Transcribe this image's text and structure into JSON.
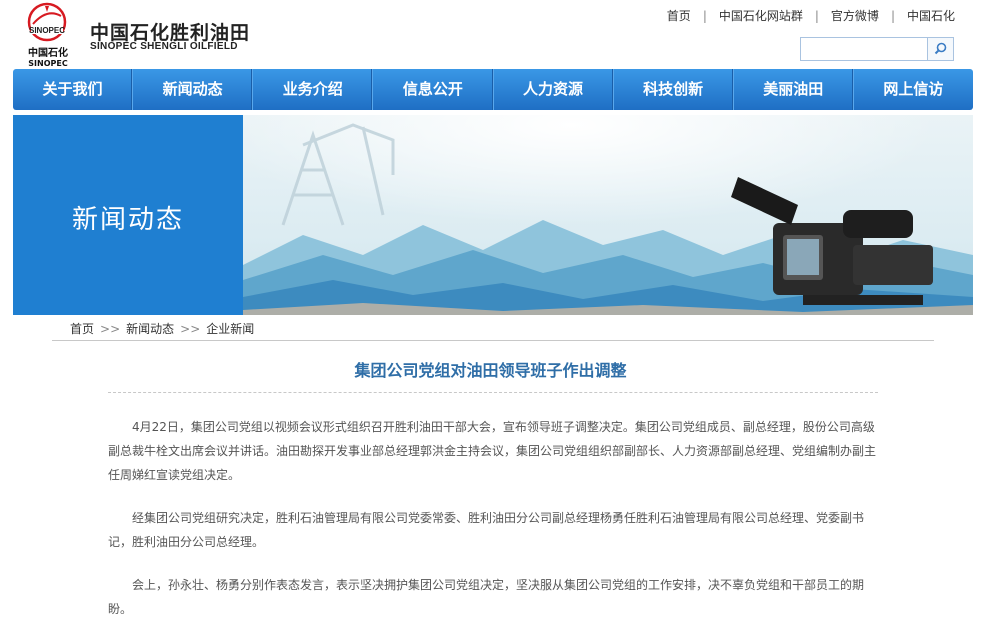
{
  "header": {
    "logo_cn": "中国石化",
    "logo_en": "SINOPEC",
    "brand_cn": "中国石化胜利油田",
    "brand_en": "SINOPEC SHENGLI OILFIELD",
    "top_links": [
      "首页",
      "中国石化网站群",
      "官方微博",
      "中国石化"
    ],
    "search": {
      "placeholder": "",
      "value": "",
      "button_icon": "search-icon"
    }
  },
  "nav": {
    "items": [
      "关于我们",
      "新闻动态",
      "业务介绍",
      "信息公开",
      "人力资源",
      "科技创新",
      "美丽油田",
      "网上信访"
    ]
  },
  "banner": {
    "title": "新闻动态"
  },
  "breadcrumb": [
    "首页",
    "新闻动态",
    "企业新闻"
  ],
  "article": {
    "title": "集团公司党组对油田领导班子作出调整",
    "paragraphs": [
      "4月22日，集团公司党组以视频会议形式组织召开胜利油田干部大会，宣布领导班子调整决定。集团公司党组成员、副总经理，股份公司高级副总裁牛栓文出席会议并讲话。油田勘探开发事业部总经理郭洪金主持会议，集团公司党组组织部副部长、人力资源部副总经理、党组编制办副主任周娣红宣读党组决定。",
      "经集团公司党组研究决定，胜利石油管理局有限公司党委常委、胜利油田分公司副总经理杨勇任胜利石油管理局有限公司总经理、党委副书记，胜利油田分公司总经理。",
      "会上，孙永壮、杨勇分别作表态发言，表示坚决拥护集团公司党组决定，坚决服从集团公司党组的工作安排，决不辜负党组和干部员工的期盼。"
    ]
  },
  "colors": {
    "nav_blue": "#2b86d9",
    "banner_blue": "#1f7fd1",
    "title_blue": "#2f6ea7",
    "logo_red": "#d71a21"
  }
}
